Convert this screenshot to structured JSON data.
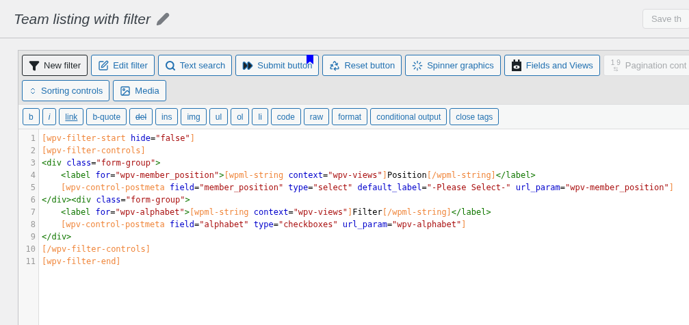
{
  "header": {
    "title": "Team listing with filter",
    "save_button": "Save th"
  },
  "toolbar": [
    {
      "label": "New filter",
      "kind": "filter",
      "selected": true,
      "disabled": false
    },
    {
      "label": "Edit filter",
      "kind": "edit",
      "selected": false,
      "disabled": false
    },
    {
      "label": "Text search",
      "kind": "search",
      "selected": false,
      "disabled": false
    },
    {
      "label": "Submit button",
      "kind": "forward",
      "selected": false,
      "disabled": false,
      "bookmarked": true
    },
    {
      "label": "Reset button",
      "kind": "recycle",
      "selected": false,
      "disabled": false
    },
    {
      "label": "Spinner graphics",
      "kind": "spinner",
      "selected": false,
      "disabled": false
    },
    {
      "label": "Fields and Views",
      "kind": "fields",
      "selected": false,
      "disabled": false
    },
    {
      "label": "Pagination cont",
      "kind": "pagination",
      "icon_text": "1 9",
      "selected": false,
      "disabled": true
    },
    {
      "label": "Sorting controls",
      "kind": "sort",
      "selected": false,
      "disabled": false
    },
    {
      "label": "Media",
      "kind": "media",
      "selected": false,
      "disabled": false
    }
  ],
  "format_buttons": [
    {
      "label": "b",
      "kind": "plain"
    },
    {
      "label": "i",
      "kind": "italic"
    },
    {
      "label": "link",
      "kind": "underline"
    },
    {
      "label": "b-quote",
      "kind": "plain"
    },
    {
      "label": "del",
      "kind": "strike"
    },
    {
      "label": "ins",
      "kind": "plain"
    },
    {
      "label": "img",
      "kind": "plain"
    },
    {
      "label": "ul",
      "kind": "plain"
    },
    {
      "label": "ol",
      "kind": "plain"
    },
    {
      "label": "li",
      "kind": "plain"
    },
    {
      "label": "code",
      "kind": "plain"
    },
    {
      "label": "raw",
      "kind": "plain"
    },
    {
      "label": "format",
      "kind": "plain"
    },
    {
      "label": "conditional output",
      "kind": "plain"
    },
    {
      "label": "close tags",
      "kind": "plain"
    }
  ],
  "editor": {
    "lines": [
      {
        "number": "1",
        "indent": false,
        "tokens": [
          {
            "kind": "sc",
            "text": "[wpv-filter-start"
          },
          {
            "kind": "attr",
            "text": " hide"
          },
          {
            "kind": "plain",
            "text": "="
          },
          {
            "kind": "str",
            "text": "\"false\""
          },
          {
            "kind": "sc",
            "text": "]"
          }
        ]
      },
      {
        "number": "2",
        "indent": false,
        "tokens": [
          {
            "kind": "sc",
            "text": "[wpv-filter-controls]"
          }
        ]
      },
      {
        "number": "3",
        "indent": false,
        "tokens": [
          {
            "kind": "tag",
            "text": "<div"
          },
          {
            "kind": "attr",
            "text": " class"
          },
          {
            "kind": "plain",
            "text": "="
          },
          {
            "kind": "str",
            "text": "\"form-group\""
          },
          {
            "kind": "tag",
            "text": ">"
          }
        ]
      },
      {
        "number": "4",
        "indent": true,
        "tokens": [
          {
            "kind": "tag",
            "text": "<label"
          },
          {
            "kind": "attr",
            "text": " for"
          },
          {
            "kind": "plain",
            "text": "="
          },
          {
            "kind": "str",
            "text": "\"wpv-member_position\""
          },
          {
            "kind": "tag",
            "text": ">"
          },
          {
            "kind": "sc",
            "text": "[wpml-string"
          },
          {
            "kind": "attr",
            "text": " context"
          },
          {
            "kind": "plain",
            "text": "="
          },
          {
            "kind": "str",
            "text": "\"wpv-views\""
          },
          {
            "kind": "sc",
            "text": "]"
          },
          {
            "kind": "plain",
            "text": "Position"
          },
          {
            "kind": "sc",
            "text": "[/wpml-string]"
          },
          {
            "kind": "tag",
            "text": "</label>"
          }
        ]
      },
      {
        "number": "5",
        "indent": true,
        "tokens": [
          {
            "kind": "sc",
            "text": "[wpv-control-postmeta"
          },
          {
            "kind": "attr",
            "text": " field"
          },
          {
            "kind": "plain",
            "text": "="
          },
          {
            "kind": "str",
            "text": "\"member_position\""
          },
          {
            "kind": "attr",
            "text": " type"
          },
          {
            "kind": "plain",
            "text": "="
          },
          {
            "kind": "str",
            "text": "\"select\""
          },
          {
            "kind": "attr",
            "text": " default_label"
          },
          {
            "kind": "plain",
            "text": "="
          },
          {
            "kind": "str",
            "text": "\"-Please Select-\""
          },
          {
            "kind": "attr",
            "text": " url_param"
          },
          {
            "kind": "plain",
            "text": "="
          },
          {
            "kind": "str",
            "text": "\"wpv-member_position\""
          },
          {
            "kind": "sc",
            "text": "]"
          }
        ]
      },
      {
        "number": "6",
        "indent": false,
        "tokens": [
          {
            "kind": "tag",
            "text": "</div><div"
          },
          {
            "kind": "attr",
            "text": " class"
          },
          {
            "kind": "plain",
            "text": "="
          },
          {
            "kind": "str",
            "text": "\"form-group\""
          },
          {
            "kind": "tag",
            "text": ">"
          }
        ]
      },
      {
        "number": "7",
        "indent": true,
        "tokens": [
          {
            "kind": "tag",
            "text": "<label"
          },
          {
            "kind": "attr",
            "text": " for"
          },
          {
            "kind": "plain",
            "text": "="
          },
          {
            "kind": "str",
            "text": "\"wpv-alphabet\""
          },
          {
            "kind": "tag",
            "text": ">"
          },
          {
            "kind": "sc",
            "text": "[wpml-string"
          },
          {
            "kind": "attr",
            "text": " context"
          },
          {
            "kind": "plain",
            "text": "="
          },
          {
            "kind": "str",
            "text": "\"wpv-views\""
          },
          {
            "kind": "sc",
            "text": "]"
          },
          {
            "kind": "plain",
            "text": "Filter"
          },
          {
            "kind": "sc",
            "text": "[/wpml-string]"
          },
          {
            "kind": "tag",
            "text": "</label>"
          }
        ]
      },
      {
        "number": "8",
        "indent": true,
        "tokens": [
          {
            "kind": "sc",
            "text": "[wpv-control-postmeta"
          },
          {
            "kind": "attr",
            "text": " field"
          },
          {
            "kind": "plain",
            "text": "="
          },
          {
            "kind": "str",
            "text": "\"alphabet\""
          },
          {
            "kind": "attr",
            "text": " type"
          },
          {
            "kind": "plain",
            "text": "="
          },
          {
            "kind": "str",
            "text": "\"checkboxes\""
          },
          {
            "kind": "attr",
            "text": " url_param"
          },
          {
            "kind": "plain",
            "text": "="
          },
          {
            "kind": "str",
            "text": "\"wpv-alphabet\""
          },
          {
            "kind": "sc",
            "text": "]"
          }
        ]
      },
      {
        "number": "9",
        "indent": false,
        "tokens": [
          {
            "kind": "tag",
            "text": "</div>"
          }
        ]
      },
      {
        "number": "10",
        "indent": false,
        "tokens": [
          {
            "kind": "sc",
            "text": "[/wpv-filter-controls]"
          }
        ]
      },
      {
        "number": "11",
        "indent": false,
        "tokens": [
          {
            "kind": "sc",
            "text": "[wpv-filter-end]"
          }
        ]
      }
    ]
  }
}
